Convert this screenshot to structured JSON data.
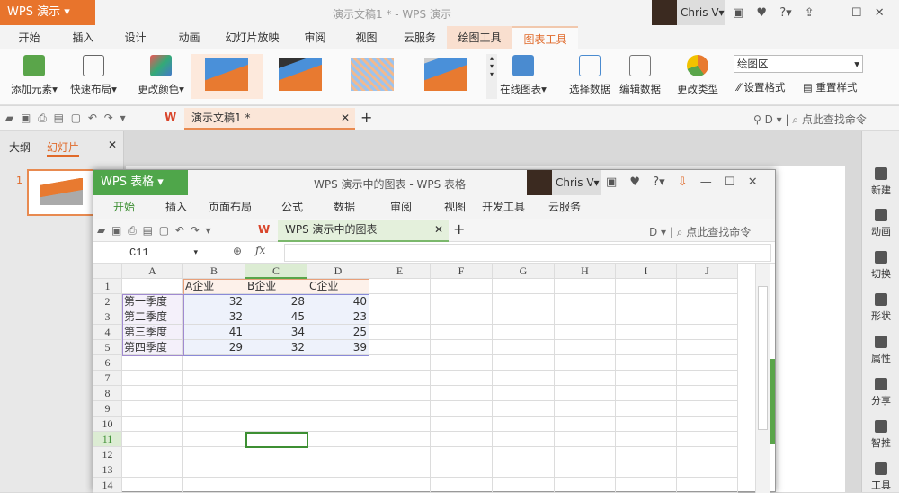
{
  "presentation": {
    "app_button": "WPS 演示",
    "doc_title": "演示文稿1 * - WPS 演示",
    "user": "Chris V",
    "tabs": [
      "开始",
      "插入",
      "设计",
      "动画",
      "幻灯片放映",
      "审阅",
      "视图",
      "云服务",
      "绘图工具",
      "图表工具"
    ],
    "ribbon": {
      "add_element": "添加元素",
      "quick_layout": "快速布局",
      "change_color": "更改颜色",
      "online_chart": "在线图表",
      "select_data": "选择数据",
      "edit_data": "编辑数据",
      "change_type": "更改类型",
      "area_select": "绘图区",
      "set_format": "设置格式",
      "reset_style": "重置样式"
    },
    "doc_tab": "演示文稿1 *",
    "search": "点此查找命令",
    "panel_tabs": [
      "大纲",
      "幻灯片"
    ],
    "slide_number": "1",
    "right_sidebar": [
      "新建",
      "动画",
      "切换",
      "形状",
      "属性",
      "分享",
      "智推",
      "工具"
    ]
  },
  "spreadsheet": {
    "app_button": "WPS 表格",
    "title": "WPS 演示中的图表 - WPS 表格",
    "user": "Chris V",
    "menu": [
      "开始",
      "插入",
      "页面布局",
      "公式",
      "数据",
      "审阅",
      "视图",
      "开发工具",
      "云服务"
    ],
    "doc_tab": "WPS 演示中的图表",
    "search": "点此查找命令",
    "name_box": "C11",
    "fx": "fx",
    "formula": "",
    "columns": [
      "A",
      "B",
      "C",
      "D",
      "E",
      "F",
      "G",
      "H",
      "I",
      "J"
    ],
    "rows": [
      [
        "",
        "A企业",
        "B企业",
        "C企业"
      ],
      [
        "第一季度",
        "32",
        "28",
        "40"
      ],
      [
        "第二季度",
        "32",
        "45",
        "23"
      ],
      [
        "第三季度",
        "41",
        "34",
        "25"
      ],
      [
        "第四季度",
        "29",
        "32",
        "39"
      ],
      [],
      [],
      [],
      [],
      [],
      [],
      [],
      [],
      []
    ]
  }
}
